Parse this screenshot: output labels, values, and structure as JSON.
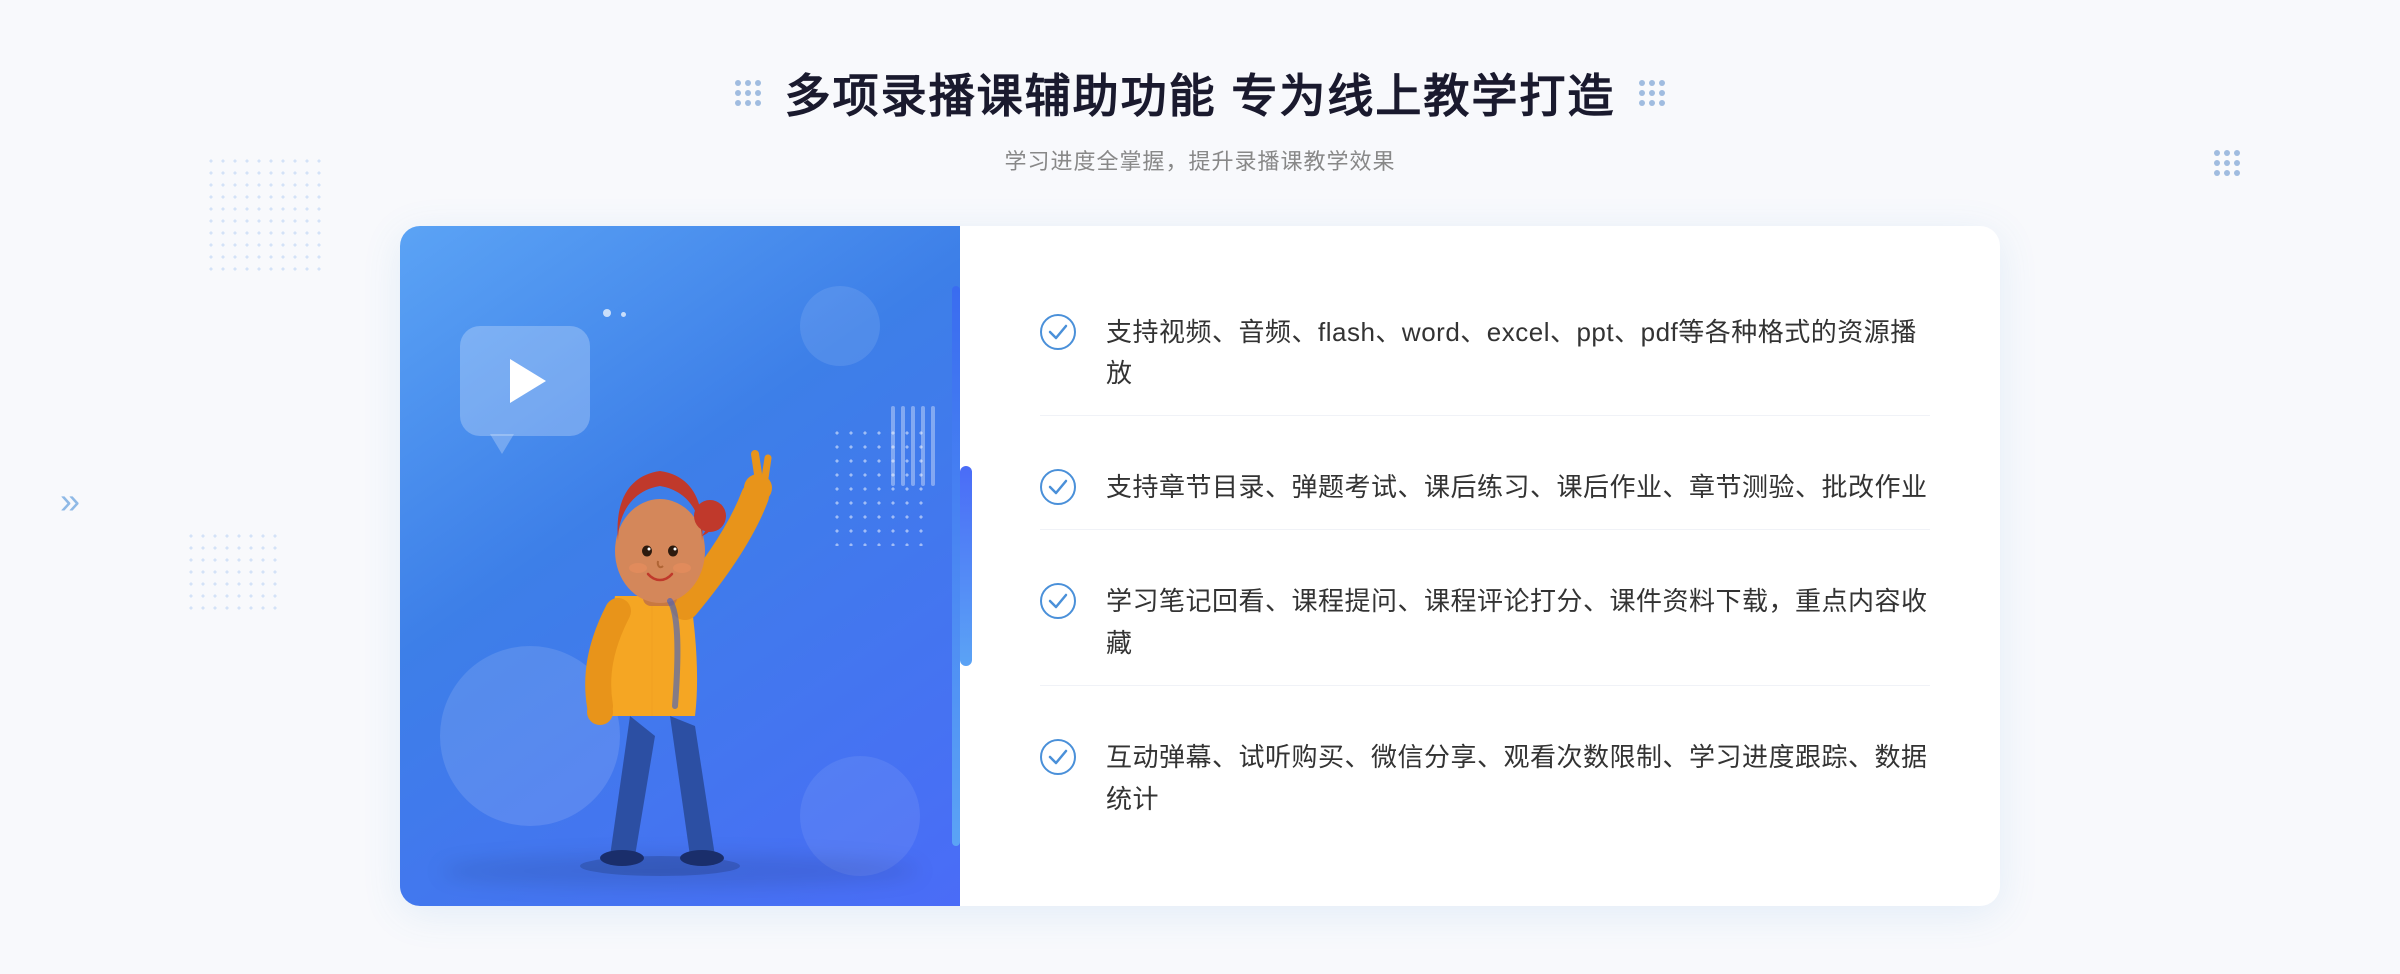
{
  "header": {
    "title": "多项录播课辅助功能 专为线上教学打造",
    "subtitle": "学习进度全掌握，提升录播课教学效果"
  },
  "features": [
    {
      "id": "feature-1",
      "text": "支持视频、音频、flash、word、excel、ppt、pdf等各种格式的资源播放"
    },
    {
      "id": "feature-2",
      "text": "支持章节目录、弹题考试、课后练习、课后作业、章节测验、批改作业"
    },
    {
      "id": "feature-3",
      "text": "学习笔记回看、课程提问、课程评论打分、课件资料下载，重点内容收藏"
    },
    {
      "id": "feature-4",
      "text": "互动弹幕、试听购买、微信分享、观看次数限制、学习进度跟踪、数据统计"
    }
  ],
  "decoration": {
    "chevron_left": "»",
    "check_color": "#4a90d9",
    "accent_blue": "#4a6cf7",
    "light_blue": "#5ba3f5"
  }
}
